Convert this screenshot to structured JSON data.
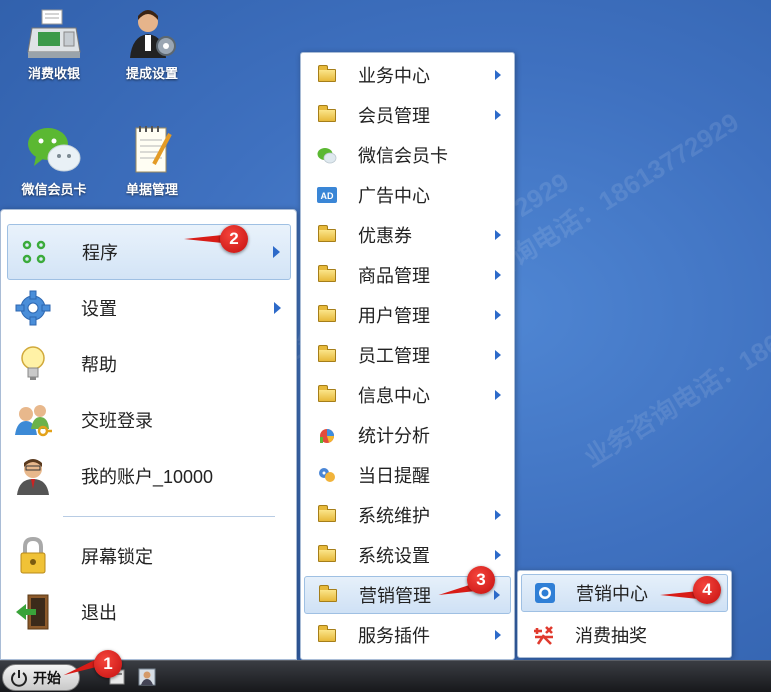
{
  "desktop": {
    "icons": [
      {
        "label": "消费收银",
        "icon": "cash-register-icon"
      },
      {
        "label": "提成设置",
        "icon": "staff-settings-icon"
      },
      {
        "label": "微信会员卡",
        "icon": "wechat-icon"
      },
      {
        "label": "单据管理",
        "icon": "notepad-icon"
      }
    ]
  },
  "start_menu": {
    "items": [
      {
        "label": "程序",
        "icon": "apps-grid-icon",
        "has_submenu": true
      },
      {
        "label": "设置",
        "icon": "gear-icon",
        "has_submenu": true
      },
      {
        "label": "帮助",
        "icon": "lightbulb-icon",
        "has_submenu": false
      },
      {
        "label": "交班登录",
        "icon": "users-key-icon",
        "has_submenu": false
      },
      {
        "label": "我的账户_10000",
        "icon": "user-account-icon",
        "has_submenu": false
      },
      {
        "label": "屏幕锁定",
        "icon": "padlock-icon",
        "has_submenu": false
      },
      {
        "label": "退出",
        "icon": "exit-door-icon",
        "has_submenu": false
      }
    ]
  },
  "programs_menu": {
    "items": [
      {
        "label": "业务中心",
        "icon": "folder-icon",
        "has_submenu": true
      },
      {
        "label": "会员管理",
        "icon": "folder-icon",
        "has_submenu": true
      },
      {
        "label": "微信会员卡",
        "icon": "wechat-icon",
        "has_submenu": false
      },
      {
        "label": "广告中心",
        "icon": "ad-icon",
        "has_submenu": false
      },
      {
        "label": "优惠券",
        "icon": "folder-icon",
        "has_submenu": true
      },
      {
        "label": "商品管理",
        "icon": "folder-icon",
        "has_submenu": true
      },
      {
        "label": "用户管理",
        "icon": "folder-icon",
        "has_submenu": true
      },
      {
        "label": "员工管理",
        "icon": "folder-icon",
        "has_submenu": true
      },
      {
        "label": "信息中心",
        "icon": "folder-icon",
        "has_submenu": true
      },
      {
        "label": "统计分析",
        "icon": "pie-chart-icon",
        "has_submenu": false
      },
      {
        "label": "当日提醒",
        "icon": "reminder-icon",
        "has_submenu": false
      },
      {
        "label": "系统维护",
        "icon": "folder-icon",
        "has_submenu": true
      },
      {
        "label": "系统设置",
        "icon": "folder-icon",
        "has_submenu": true
      },
      {
        "label": "营销管理",
        "icon": "folder-icon",
        "has_submenu": true
      },
      {
        "label": "服务插件",
        "icon": "folder-icon",
        "has_submenu": true
      }
    ]
  },
  "marketing_menu": {
    "items": [
      {
        "label": "营销中心",
        "icon": "marketing-center-icon"
      },
      {
        "label": "消费抽奖",
        "icon": "lottery-icon"
      }
    ]
  },
  "taskbar": {
    "start_label": "开始"
  },
  "callouts": [
    "1",
    "2",
    "3",
    "4"
  ],
  "watermark": {
    "text": "业务咨询电话：18613772929"
  },
  "colors": {
    "desktop": "#3f71c0",
    "accent_arrow": "#2d6ac9",
    "callout": "#d81c17"
  }
}
